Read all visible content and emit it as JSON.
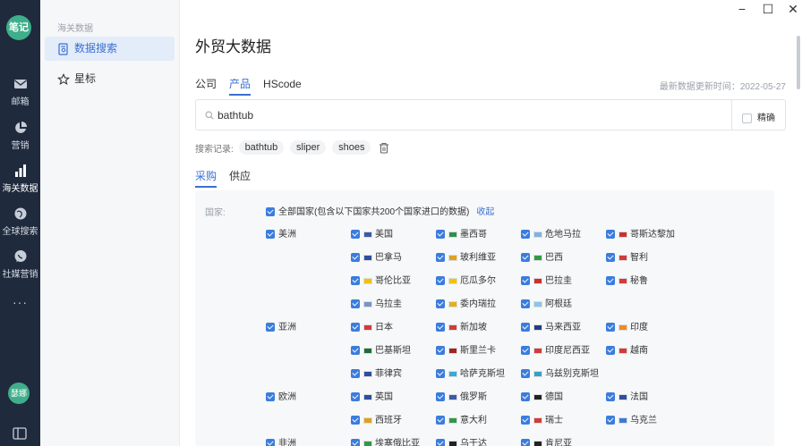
{
  "rail": {
    "logo": "笔记",
    "items": [
      {
        "label": "邮箱",
        "icon": "mail-icon"
      },
      {
        "label": "营销",
        "icon": "pie-chart-icon"
      },
      {
        "label": "海关数据",
        "icon": "bar-chart-icon"
      },
      {
        "label": "全球搜索",
        "icon": "globe-icon"
      },
      {
        "label": "社媒营销",
        "icon": "chat-icon"
      }
    ],
    "more": "···",
    "avatar": "瑟娜"
  },
  "sidenav": {
    "section_title": "海关数据",
    "items": [
      {
        "label": "数据搜索",
        "icon": "document-search-icon"
      },
      {
        "label": "星标",
        "icon": "star-icon"
      }
    ]
  },
  "window": {
    "minimize": "−",
    "maximize": "☐",
    "close": "✕"
  },
  "main": {
    "title": "外贸大数据",
    "tabs": [
      "公司",
      "产品",
      "HScode"
    ],
    "active_tab": "产品",
    "update_text": "最新数据更新时间：2022-05-27",
    "search": {
      "value": "bathtub",
      "exact_label": "精确"
    },
    "history": {
      "label": "搜索记录:",
      "items": [
        "bathtub",
        "sliper",
        "shoes"
      ]
    },
    "subtabs": [
      "采购",
      "供应"
    ],
    "active_subtab": "采购",
    "country_label": "国家:",
    "all_label": "全部国家(包含以下国家共200个国家进口的数据)",
    "collapse_label": "收起",
    "continents": [
      {
        "name": "美洲",
        "countries": [
          {
            "name": "美国",
            "flag": "#3c5aa6"
          },
          {
            "name": "墨西哥",
            "flag": "#2f8f4e"
          },
          {
            "name": "危地马拉",
            "flag": "#7fb3e0"
          },
          {
            "name": "哥斯达黎加",
            "flag": "#c8312f"
          },
          {
            "name": "巴拿马",
            "flag": "#2c4fa0"
          },
          {
            "name": "玻利维亚",
            "flag": "#e0a020"
          },
          {
            "name": "巴西",
            "flag": "#2f9a45"
          },
          {
            "name": "智利",
            "flag": "#d33a3a"
          },
          {
            "name": "哥伦比亚",
            "flag": "#f2c300"
          },
          {
            "name": "厄瓜多尔",
            "flag": "#f2c300"
          },
          {
            "name": "巴拉圭",
            "flag": "#c8312f"
          },
          {
            "name": "秘鲁",
            "flag": "#d33a3a"
          },
          {
            "name": "乌拉圭",
            "flag": "#7a93c8"
          },
          {
            "name": "委内瑞拉",
            "flag": "#e0b020"
          },
          {
            "name": "阿根廷",
            "flag": "#8fc4ea"
          }
        ]
      },
      {
        "name": "亚洲",
        "countries": [
          {
            "name": "日本",
            "flag": "#d33a3a"
          },
          {
            "name": "新加坡",
            "flag": "#d33a3a"
          },
          {
            "name": "马来西亚",
            "flag": "#1f3c88"
          },
          {
            "name": "印度",
            "flag": "#f08a24"
          },
          {
            "name": "巴基斯坦",
            "flag": "#1f6b3a"
          },
          {
            "name": "斯里兰卡",
            "flag": "#a3251f"
          },
          {
            "name": "印度尼西亚",
            "flag": "#d33a3a"
          },
          {
            "name": "越南",
            "flag": "#d33a3a"
          },
          {
            "name": "菲律宾",
            "flag": "#2c4fa0"
          },
          {
            "name": "哈萨克斯坦",
            "flag": "#39a9d6"
          },
          {
            "name": "乌兹别克斯坦",
            "flag": "#3aa0c8"
          }
        ]
      },
      {
        "name": "欧洲",
        "countries": [
          {
            "name": "英国",
            "flag": "#2c4fa0"
          },
          {
            "name": "俄罗斯",
            "flag": "#3c5aa6"
          },
          {
            "name": "德国",
            "flag": "#222222"
          },
          {
            "name": "法国",
            "flag": "#2c4fa0"
          },
          {
            "name": "西班牙",
            "flag": "#e0a020"
          },
          {
            "name": "意大利",
            "flag": "#2f9a45"
          },
          {
            "name": "瑞士",
            "flag": "#d33a3a"
          },
          {
            "name": "乌克兰",
            "flag": "#3a7bd5"
          }
        ]
      },
      {
        "name": "非洲",
        "countries": [
          {
            "name": "埃塞俄比亚",
            "flag": "#2f9a45"
          },
          {
            "name": "乌干达",
            "flag": "#222222"
          },
          {
            "name": "肯尼亚",
            "flag": "#222222"
          }
        ]
      }
    ]
  }
}
